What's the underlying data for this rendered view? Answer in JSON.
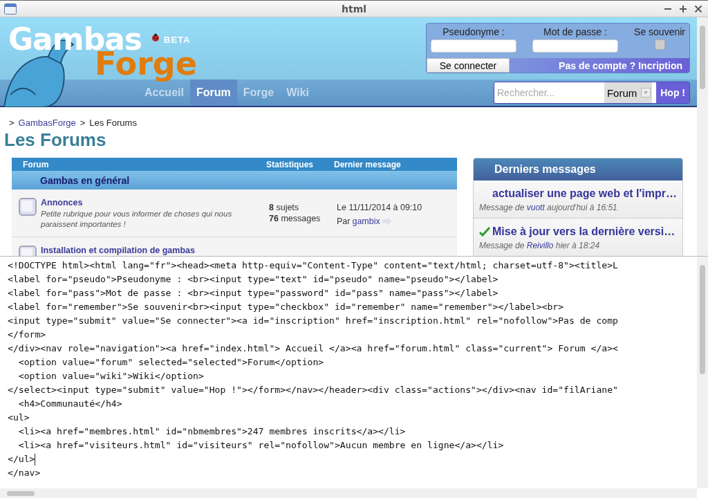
{
  "window": {
    "title": "html"
  },
  "header": {
    "logo": {
      "title": "Gambas",
      "subtitle": "Forge",
      "badge": "BETA"
    },
    "login": {
      "pseudo_label": "Pseudonyme :",
      "password_label": "Mot de passe :",
      "remember_label": "Se souvenir",
      "remember_checked": false,
      "connect_button": "Se connecter",
      "signup_link": "Pas de compte ? Incription"
    },
    "nav": [
      {
        "label": "Accueil",
        "selected": false
      },
      {
        "label": "Forum",
        "selected": true
      },
      {
        "label": "Forge",
        "selected": false
      },
      {
        "label": "Wiki",
        "selected": false
      }
    ],
    "search": {
      "placeholder": "Rechercher...",
      "scope": "Forum",
      "button": "Hop !"
    }
  },
  "breadcrumb": {
    "separator": ">",
    "items": [
      "GambasForge",
      "Les Forums"
    ]
  },
  "page_title": "Les Forums",
  "forum_table": {
    "columns": [
      "Forum",
      "Statistiques",
      "Dernier message"
    ],
    "category": "Gambas en général",
    "rows": [
      {
        "title": "Annonces",
        "description": "Petite rubrique pour vous informer de choses qui nous paraissent importantes !",
        "topics_count": "8",
        "topics_label": "sujets",
        "messages_count": "76",
        "messages_label": "messages",
        "last_date": "Le 11/11/2014 à 09:10",
        "by_label": "Par",
        "last_author": "gambix"
      },
      {
        "title": "Installation et compilation de gambas"
      }
    ]
  },
  "latest": {
    "title": "Derniers messages",
    "items": [
      {
        "title": "actualiser une page web et l'impr…",
        "solved": false,
        "prefix": "Message de",
        "author": "vuott",
        "when": "aujourd'hui à 16:51"
      },
      {
        "title": "Mise à jour vers la dernière versi…",
        "solved": true,
        "prefix": "Message de",
        "author": "Reivillo",
        "when": "hier à 18:24"
      }
    ]
  },
  "editor": {
    "lines": [
      {
        "text": "<!DOCTYPE html><html lang=\"fr\"><head><meta http-equiv=\"Content-Type\" content=\"text/html; charset=utf-8\"><title>L",
        "cursor": false
      },
      {
        "text": "<label for=\"pseudo\">Pseudonyme : <br><input type=\"text\" id=\"pseudo\" name=\"pseudo\"></label>",
        "cursor": false
      },
      {
        "text": "<label for=\"pass\">Mot de passe : <br><input type=\"password\" id=\"pass\" name=\"pass\"></label>",
        "cursor": false
      },
      {
        "text": "<label for=\"remember\">Se souvenir<br><input type=\"checkbox\" id=\"remember\" name=\"remember\"></label><br>",
        "cursor": false
      },
      {
        "text": "<input type=\"submit\" value=\"Se connecter\"><a id=\"inscription\" href=\"inscription.html\" rel=\"nofollow\">Pas de comp",
        "cursor": false
      },
      {
        "text": "</form>",
        "cursor": false
      },
      {
        "text": "</div><nav role=\"navigation\"><a href=\"index.html\"> Accueil </a><a href=\"forum.html\" class=\"current\"> Forum </a><",
        "cursor": false
      },
      {
        "text": "  <option value=\"forum\" selected=\"selected\">Forum</option>",
        "cursor": false
      },
      {
        "text": "  <option value=\"wiki\">Wiki</option>",
        "cursor": false
      },
      {
        "text": "</select><input type=\"submit\" value=\"Hop !\"></form></nav></header><div class=\"actions\"></div><nav id=\"filAriane\"",
        "cursor": false
      },
      {
        "text": "  <h4>Communauté</h4>",
        "cursor": false
      },
      {
        "text": "<ul>",
        "cursor": false
      },
      {
        "text": "  <li><a href=\"membres.html\" id=\"nbmembres\">247 membres inscrits</a></li>",
        "cursor": false
      },
      {
        "text": "  <li><a href=\"visiteurs.html\" id=\"visiteurs\" rel=\"nofollow\">Aucun membre en ligne</a></li>",
        "cursor": false
      },
      {
        "text": "</ul>",
        "cursor": true
      },
      {
        "text": "</nav>",
        "cursor": false
      }
    ]
  }
}
